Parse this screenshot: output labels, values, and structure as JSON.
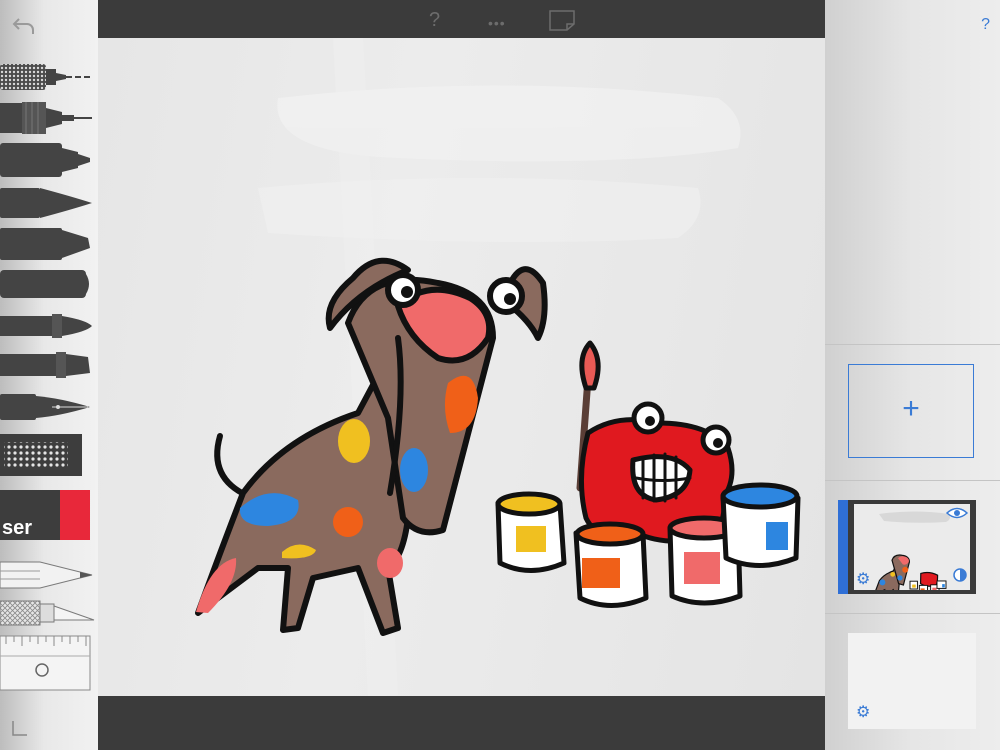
{
  "toolbar": {
    "help_label": "?",
    "more_label": "•••",
    "undo_icon": "undo-arrow-icon",
    "tools": [
      {
        "id": "technical-pen",
        "icon": "technical-pen-icon"
      },
      {
        "id": "fineliner",
        "icon": "fineliner-icon"
      },
      {
        "id": "marker",
        "icon": "marker-icon"
      },
      {
        "id": "brush-pen",
        "icon": "brush-pen-icon"
      },
      {
        "id": "chisel-marker",
        "icon": "chisel-marker-icon"
      },
      {
        "id": "felt-tip",
        "icon": "felt-tip-icon"
      },
      {
        "id": "watercolor-brush",
        "icon": "watercolor-brush-icon"
      },
      {
        "id": "flat-brush",
        "icon": "flat-brush-icon"
      },
      {
        "id": "fountain-pen",
        "icon": "fountain-pen-icon"
      },
      {
        "id": "dotted-texture",
        "icon": "dotted-texture-icon"
      },
      {
        "id": "eraser",
        "icon": "eraser-icon",
        "label": "ser",
        "color": "#e8283a"
      },
      {
        "id": "pencil",
        "icon": "pencil-icon"
      },
      {
        "id": "x-acto-knife",
        "icon": "knife-icon"
      },
      {
        "id": "ruler",
        "icon": "ruler-icon"
      }
    ]
  },
  "layers": {
    "help_label": "?",
    "add_label": "+",
    "items": [
      {
        "name": "drawing-layer",
        "selected": true,
        "visible": true
      },
      {
        "name": "blank-layer",
        "selected": false,
        "visible": true
      }
    ]
  },
  "colors": {
    "accent": "#3a7bd5",
    "chrome_dark": "#3b3b3b",
    "dog_brown": "#8a6a5e",
    "paint_red": "#e0191f",
    "spot_orange": "#f06018",
    "spot_blue": "#2d86e0",
    "spot_yellow": "#f0c020",
    "spot_pink": "#f06a6a"
  }
}
